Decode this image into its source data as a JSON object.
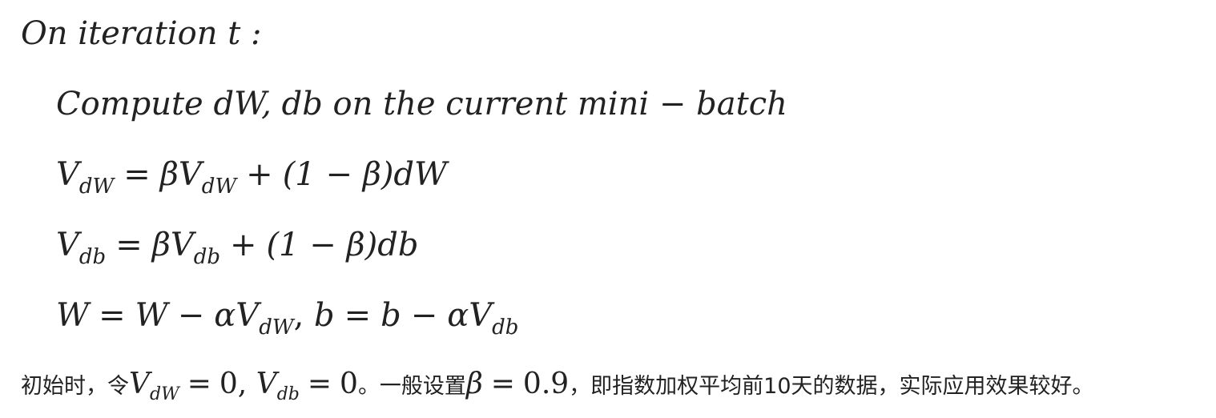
{
  "lines": {
    "l0": {
      "text": "On iteration t :"
    },
    "l1": {
      "text": "Compute dW, db on the current mini − batch"
    },
    "l2": {
      "lhs_V": "V",
      "lhs_sub": "dW",
      "eq": "=",
      "beta": "β",
      "V": "V",
      "sub": "dW",
      "plus": "+",
      "rest": "(1 − β)dW"
    },
    "l3": {
      "lhs_V": "V",
      "lhs_sub": "db",
      "eq": "=",
      "beta": "β",
      "V": "V",
      "sub": "db",
      "plus": "+",
      "rest": "(1 − β)db"
    },
    "l4": {
      "a": "W",
      "eq1": "=",
      "b": "W",
      "minus1": "−",
      "alphaV": "αV",
      "sub1": "dW",
      "comma": ",",
      "c": "b",
      "eq2": "=",
      "d": "b",
      "minus2": "−",
      "alphaV2": "αV",
      "sub2": "db"
    }
  },
  "note": {
    "p1": "初始时，令",
    "v1": "V",
    "s1": "dW",
    "eq1": "=",
    "z1": "0,",
    "v2": "V",
    "s2": "db",
    "eq2": "=",
    "z2": "0",
    "p2": "。一般设置",
    "beta": "β",
    "eq3": "=",
    "val": "0.9",
    "p3": "，即指数加权平均前10天的数据，实际应用效果较好。"
  }
}
